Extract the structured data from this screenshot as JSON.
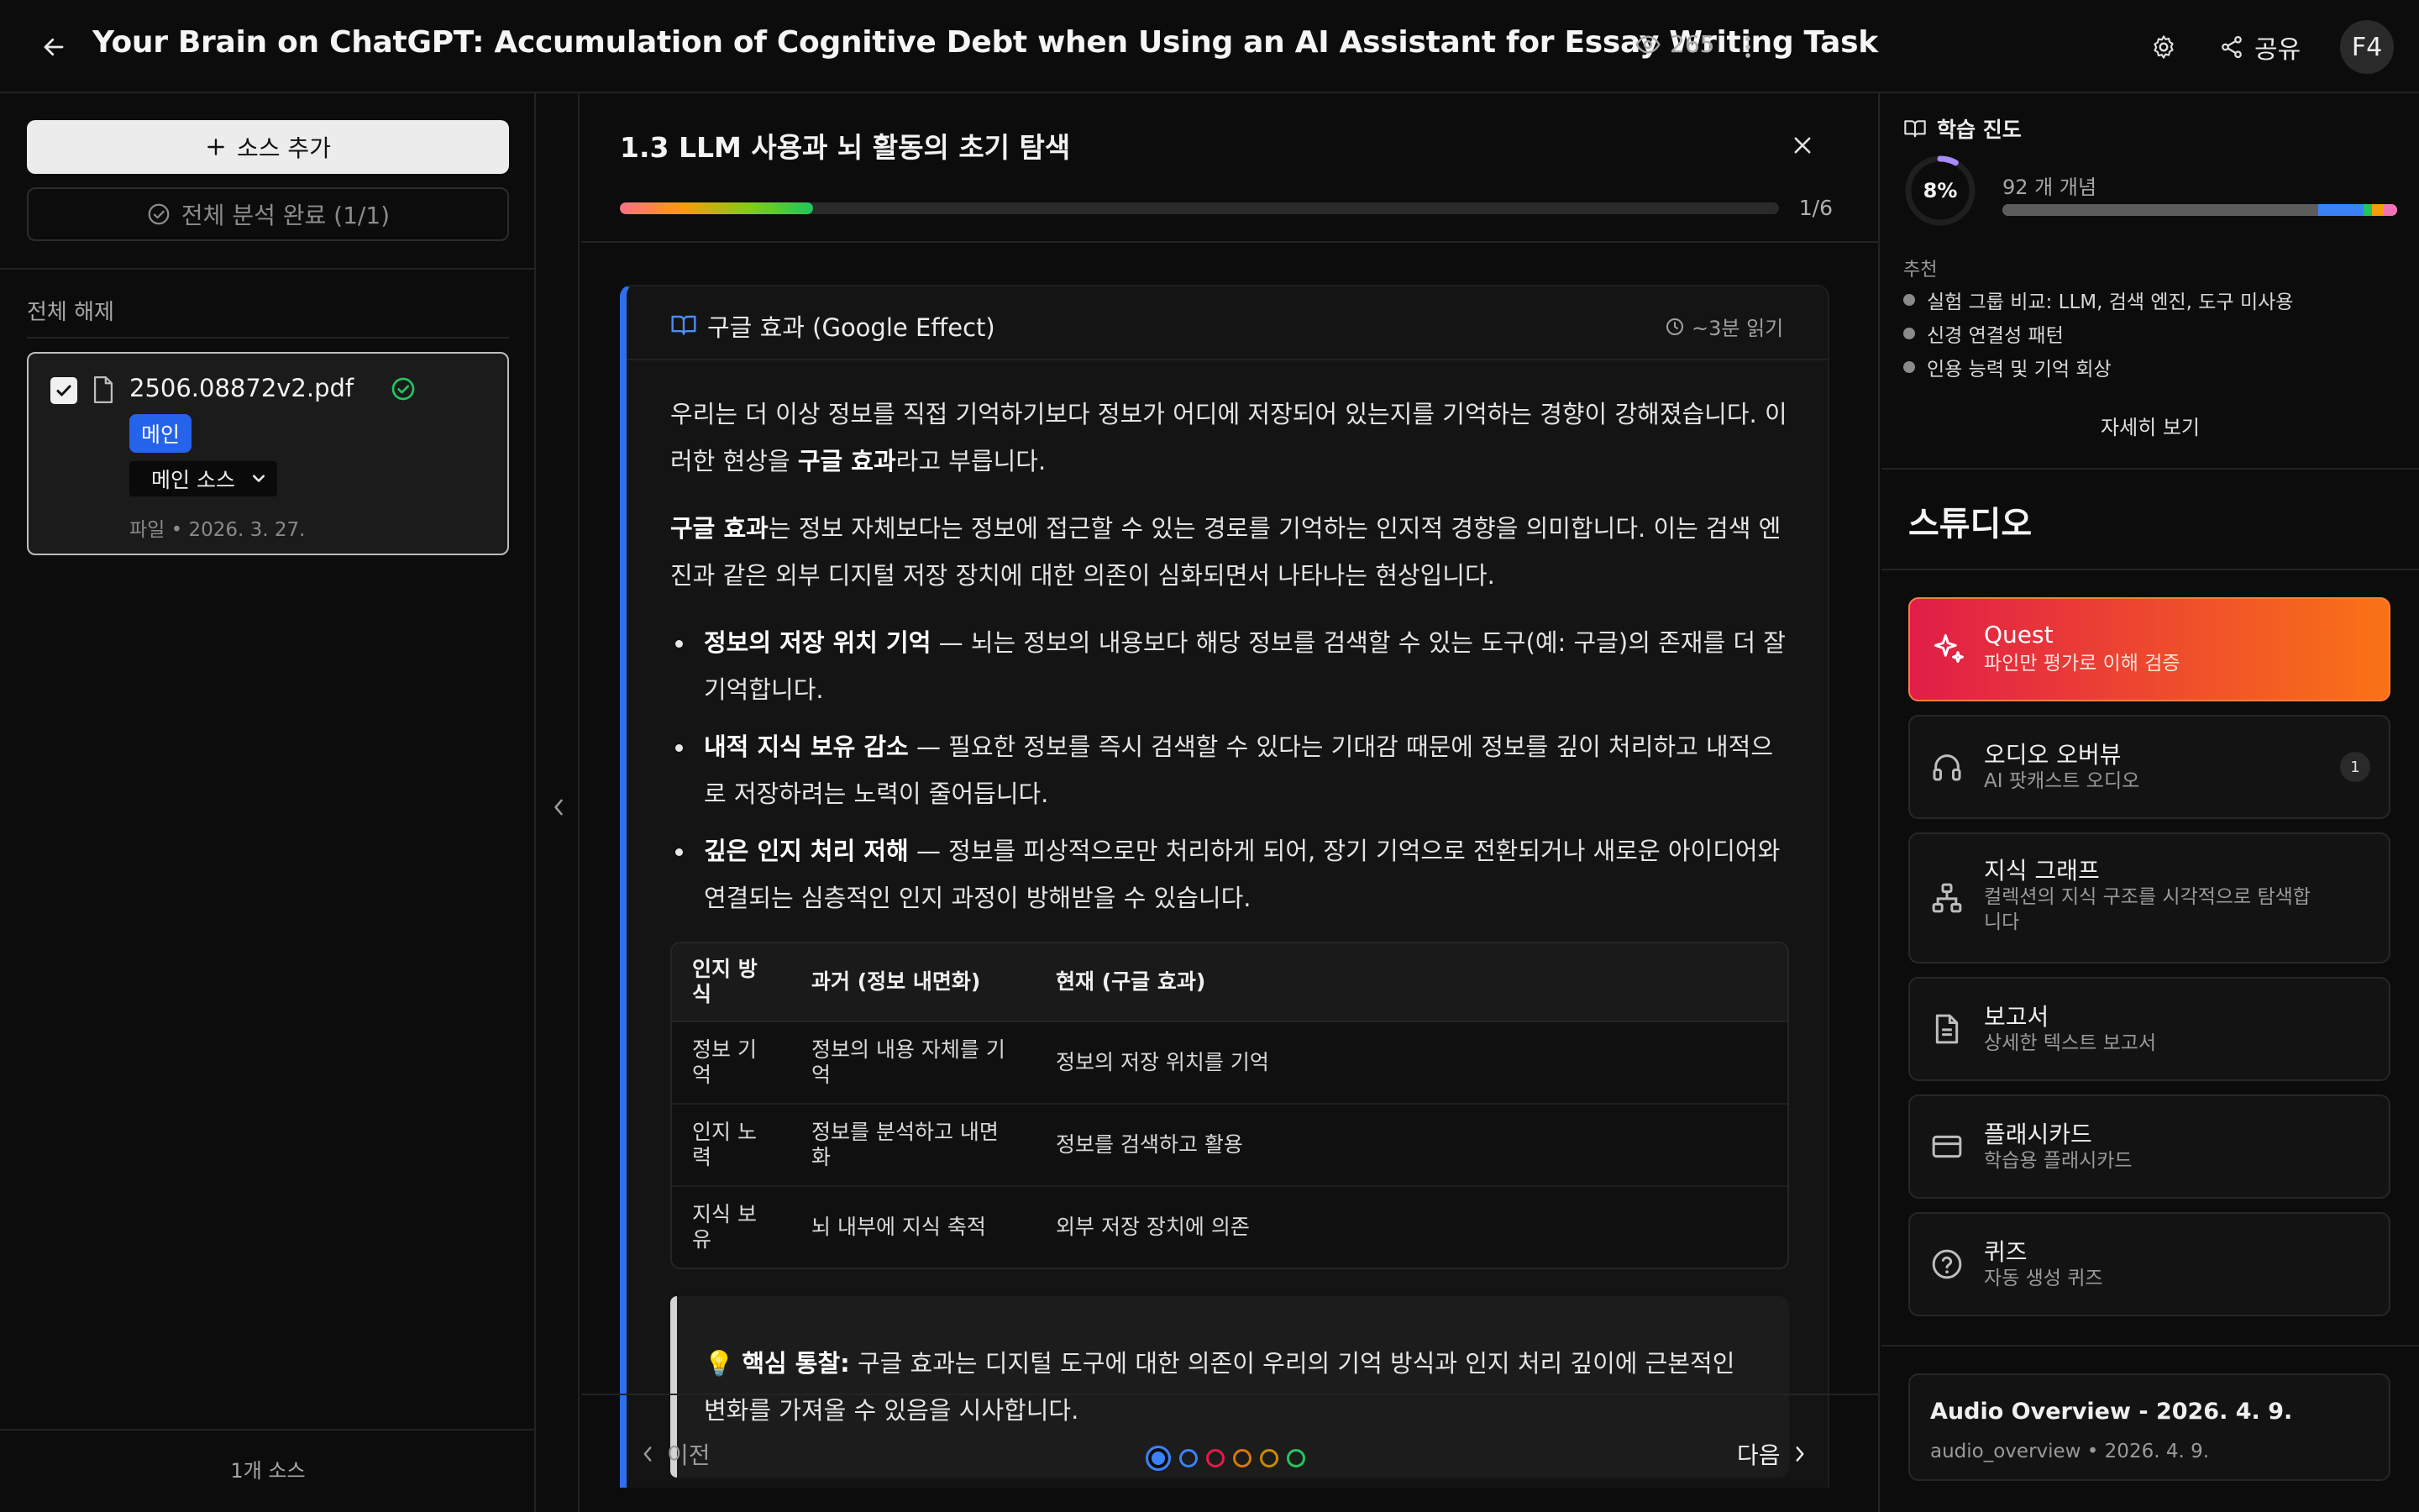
{
  "header": {
    "title": "Your Brain on ChatGPT: Accumulation of Cognitive Debt when Using an AI Assistant for Essay Writing Task",
    "views": "265",
    "share_label": "공유",
    "avatar_initials": "F4",
    "icons": [
      "arrow-left-icon",
      "eye-icon",
      "more-vertical-icon",
      "gear-icon",
      "share-icon"
    ]
  },
  "sidebar": {
    "add_source_label": "소스 추가",
    "analysis_status": "전체 분석 완료 (1/1)",
    "deselect_all": "전체 해제",
    "sources": [
      {
        "name": "2506.08872v2.pdf",
        "checked": true,
        "badge": "메인",
        "type_selected": "메인 소스",
        "meta": "파일 • 2026. 3. 27."
      }
    ],
    "source_count": "1개 소스"
  },
  "lesson": {
    "title": "1.3 LLM 사용과 뇌 활동의 초기 탐색",
    "step_label": "1/6",
    "progress_fraction": 0.167,
    "card": {
      "title": "구글 효과 (Google Effect)",
      "read_time": "~3분 읽기",
      "para1_a": "우리는 더 이상 정보를 직접 기억하기보다 정보가 어디에 저장되어 있는지를 기억하는 경향이 강해졌습니다. 이러한 현상을 ",
      "para1_bold": "구글 효과",
      "para1_b": "라고 부릅니다.",
      "para2_bold": "구글 효과",
      "para2_b": "는 정보 자체보다는 정보에 접근할 수 있는 경로를 기억하는 인지적 경향을 의미합니다. 이는 검색 엔진과 같은 외부 디지털 저장 장치에 대한 의존이 심화되면서 나타나는 현상입니다.",
      "bullets": [
        {
          "term": "정보의 저장 위치 기억",
          "text": " — 뇌는 정보의 내용보다 해당 정보를 검색할 수 있는 도구(예: 구글)의 존재를 더 잘 기억합니다."
        },
        {
          "term": "내적 지식 보유 감소",
          "text": " — 필요한 정보를 즉시 검색할 수 있다는 기대감 때문에 정보를 깊이 처리하고 내적으로 저장하려는 노력이 줄어듭니다."
        },
        {
          "term": "깊은 인지 처리 저해",
          "text": " — 정보를 피상적으로만 처리하게 되어, 장기 기억으로 전환되거나 새로운 아이디어와 연결되는 심층적인 인지 과정이 방해받을 수 있습니다."
        }
      ],
      "table": {
        "headers": [
          "인지 방식",
          "과거 (정보 내면화)",
          "현재 (구글 효과)"
        ],
        "rows": [
          [
            "정보 기억",
            "정보의 내용 자체를 기억",
            "정보의 저장 위치를 기억"
          ],
          [
            "인지 노력",
            "정보를 분석하고 내면화",
            "정보를 검색하고 활용"
          ],
          [
            "지식 보유",
            "뇌 내부에 지식 축적",
            "외부 저장 장치에 의존"
          ]
        ]
      },
      "insight_emoji": "💡",
      "insight_label": "핵심 통찰:",
      "insight_text": " 구글 효과는 디지털 도구에 대한 의존이 우리의 기억 방식과 인지 처리 깊이에 근본적인 변화를 가져올 수 있음을 시사합니다."
    },
    "prev_label": "이전",
    "next_label": "다음",
    "step_dot_colors": [
      "#3b82f6",
      "#3b82f6",
      "#e11d48",
      "#d97706",
      "#ca8a04",
      "#22c55e"
    ],
    "active_step": 1
  },
  "right_panel": {
    "progress_heading": "학습 진도",
    "progress_percent": "8%",
    "progress_value": 0.08,
    "concept_count": "92 개 개념",
    "recommend_label": "추천",
    "recommendations": [
      "실험 그룹 비교: LLM, 검색 엔진, 도구 미사용",
      "신경 연결성 패턴",
      "인용 능력 및 기억 회상"
    ],
    "see_more": "자세히 보기",
    "studio_title": "스튜디오",
    "tools": [
      {
        "name": "Quest",
        "desc": "파인만 평가로 이해 검증",
        "icon": "sparkle-icon"
      },
      {
        "name": "오디오 오버뷰",
        "desc": "AI 팟캐스트 오디오",
        "icon": "headphones-icon",
        "badge": "1"
      },
      {
        "name": "지식 그래프",
        "desc": "컬렉션의 지식 구조를 시각적으로 탐색합니다",
        "icon": "network-icon"
      },
      {
        "name": "보고서",
        "desc": "상세한 텍스트 보고서",
        "icon": "document-icon"
      },
      {
        "name": "플래시카드",
        "desc": "학습용 플래시카드",
        "icon": "card-icon"
      },
      {
        "name": "퀴즈",
        "desc": "자동 생성 퀴즈",
        "icon": "question-circle-icon"
      }
    ],
    "audio_card": {
      "title": "Audio Overview - 2026. 4. 9.",
      "meta": "audio_overview • 2026. 4. 9."
    }
  }
}
